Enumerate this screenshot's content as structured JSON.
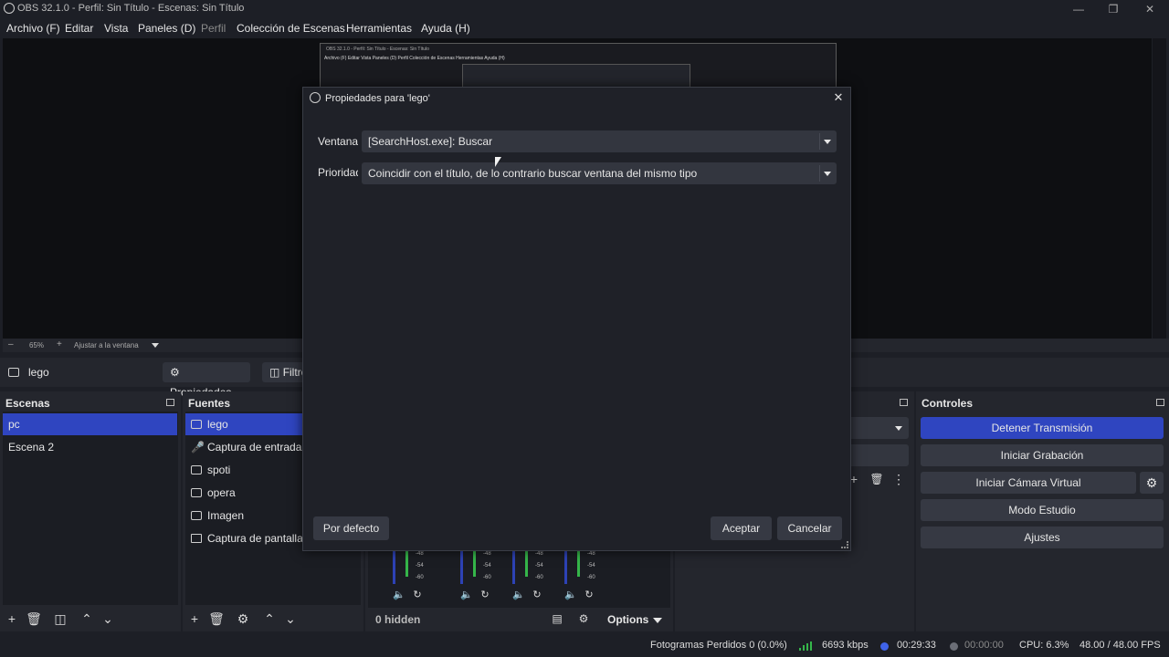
{
  "app": {
    "window_title": "OBS 32.1.0 - Perfil: Sin Título - Escenas: Sin Título"
  },
  "menu": [
    {
      "label": "Archivo (F)",
      "enabled": true
    },
    {
      "label": "Editar",
      "enabled": true
    },
    {
      "label": "Vista",
      "enabled": true
    },
    {
      "label": "Paneles (D)",
      "enabled": true
    },
    {
      "label": "Perfil",
      "enabled": false
    },
    {
      "label": "Colección de Escenas",
      "enabled": true
    },
    {
      "label": "Herramientas",
      "enabled": true
    },
    {
      "label": "Ayuda (H)",
      "enabled": true
    }
  ],
  "preview": {
    "thumb_title": "OBS 32.1.0 - Perfil: Sin Título - Escenas: Sin Título",
    "thumb_menu": "Archivo (F)   Editar   Vista   Paneles (D)   Perfil   Colección de Escenas   Herramientas   Ayuda (H)",
    "zoom": "65%",
    "fit_label": "Ajustar a la ventana"
  },
  "source_toolbar": {
    "current_source": "lego",
    "properties_label": "Propiedades",
    "filters_label": "Filtros"
  },
  "scenes": {
    "title": "Escenas",
    "items": [
      {
        "label": "pc",
        "selected": true
      },
      {
        "label": "Escena 2",
        "selected": false
      }
    ]
  },
  "sources": {
    "title": "Fuentes",
    "items": [
      {
        "label": "lego",
        "icon": "window-capture-icon",
        "selected": true
      },
      {
        "label": "Captura de entrada a",
        "icon": "microphone-icon",
        "selected": false
      },
      {
        "label": "spoti",
        "icon": "window-capture-icon",
        "selected": false
      },
      {
        "label": "opera",
        "icon": "window-capture-icon",
        "selected": false
      },
      {
        "label": "Imagen",
        "icon": "image-icon",
        "selected": false
      },
      {
        "label": "Captura de pantalla",
        "icon": "monitor-icon",
        "selected": false
      }
    ]
  },
  "mixer": {
    "db_marks": [
      "-48",
      "-54",
      "-60"
    ],
    "hidden_label": "0 hidden",
    "options_label": "Options"
  },
  "controls": {
    "title": "Controles",
    "buttons": [
      {
        "label": "Detener Transmisión",
        "active": true
      },
      {
        "label": "Iniciar Grabación",
        "active": false
      },
      {
        "label": "Iniciar Cámara Virtual",
        "active": false
      },
      {
        "label": "Modo Estudio",
        "active": false
      },
      {
        "label": "Ajustes",
        "active": false
      }
    ]
  },
  "status": {
    "dropped_frames": "Fotogramas Perdidos 0 (0.0%)",
    "bitrate": "6693 kbps",
    "stream_time": "00:29:33",
    "record_time": "00:00:00",
    "cpu": "CPU: 6.3%",
    "fps": "48.00 / 48.00 FPS"
  },
  "dialog": {
    "title": "Propiedades para 'lego'",
    "fields": [
      {
        "label": "Ventana",
        "value": "[SearchHost.exe]: Buscar"
      },
      {
        "label": "Prioridad",
        "value": "Coincidir con el título, de lo contrario buscar ventana del mismo tipo"
      }
    ],
    "defaults_label": "Por defecto",
    "ok_label": "Aceptar",
    "cancel_label": "Cancelar"
  },
  "colors": {
    "accent": "#2f45c0",
    "background": "#1d1f26",
    "panel": "#24262d"
  }
}
